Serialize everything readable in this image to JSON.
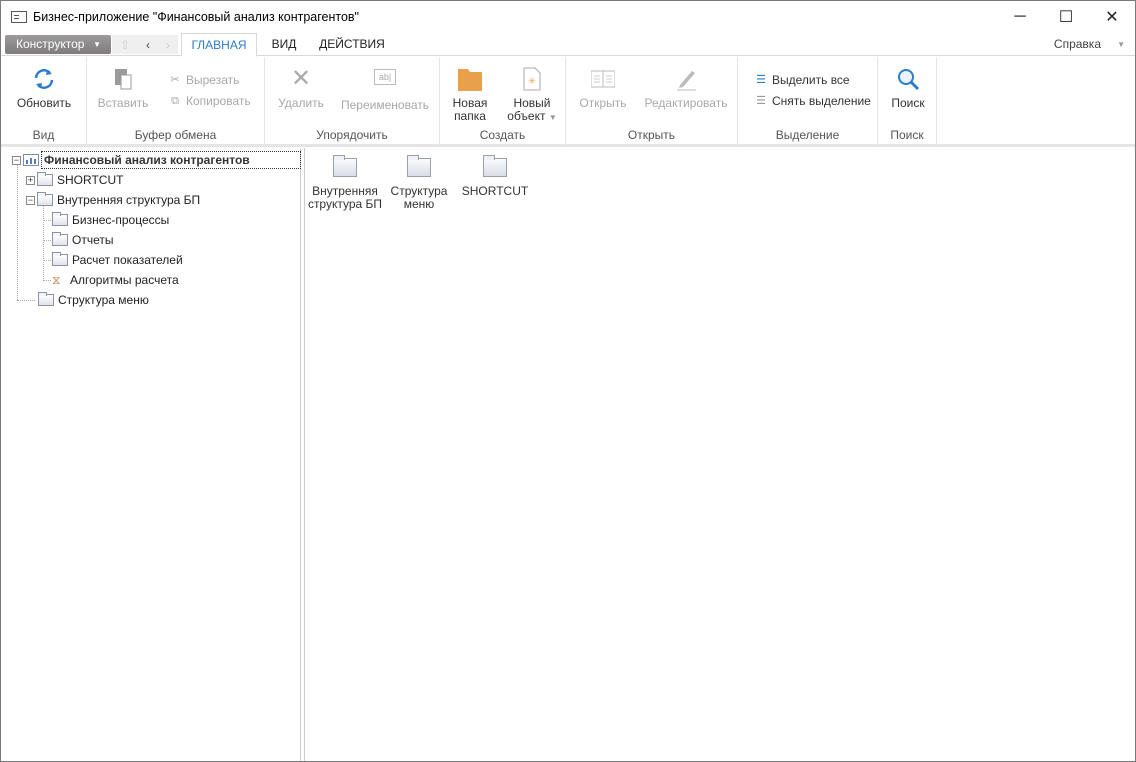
{
  "window": {
    "title": "Бизнес-приложение \"Финансовый анализ контрагентов\"",
    "minimize": "─",
    "maximize": "☐",
    "close": "✕"
  },
  "tabbar": {
    "designer": "Конструктор",
    "tabs": [
      "ГЛАВНАЯ",
      "ВИД",
      "ДЕЙСТВИЯ"
    ],
    "active_tab": "ГЛАВНАЯ",
    "help": "Справка"
  },
  "ribbon": {
    "view": {
      "label": "Вид",
      "refresh": "Обновить"
    },
    "clipboard": {
      "label": "Буфер обмена",
      "paste": "Вставить",
      "cut": "Вырезать",
      "copy": "Копировать"
    },
    "arrange": {
      "label": "Упорядочить",
      "delete": "Удалить",
      "rename": "Переименовать"
    },
    "create": {
      "label": "Создать",
      "new_folder_1": "Новая",
      "new_folder_2": "папка",
      "new_object_1": "Новый",
      "new_object_2": "объект"
    },
    "open": {
      "label": "Открыть",
      "open": "Открыть",
      "edit": "Редактировать"
    },
    "selection": {
      "label": "Выделение",
      "select_all": "Выделить все",
      "deselect": "Снять выделение"
    },
    "search": {
      "label": "Поиск",
      "search": "Поиск"
    }
  },
  "colors": {
    "accent": "#2a7dc8",
    "folder_orange": "#e9a04a"
  },
  "tree": {
    "root": "Финансовый анализ контрагентов",
    "shortcut": "SHORTCUT",
    "internal": "Внутренняя структура БП",
    "children": [
      "Бизнес-процессы",
      "Отчеты",
      "Расчет показателей",
      "Алгоритмы расчета"
    ],
    "menu": "Структура меню"
  },
  "content": {
    "items": [
      {
        "line1": "Внутренняя",
        "line2": "структура БП"
      },
      {
        "line1": "Структура",
        "line2": "меню"
      },
      {
        "line1": "SHORTCUT",
        "line2": ""
      }
    ]
  }
}
